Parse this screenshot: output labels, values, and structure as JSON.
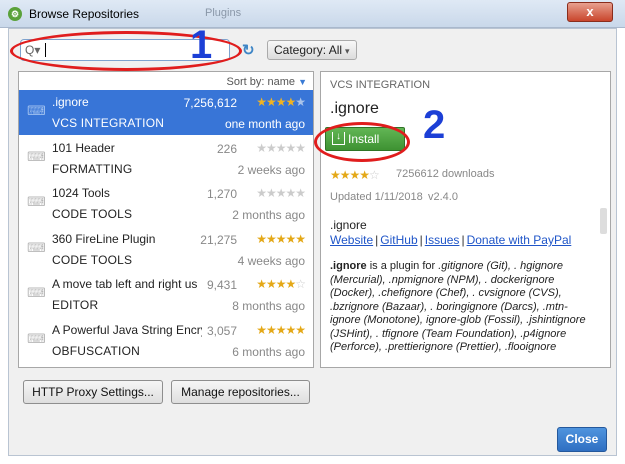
{
  "window": {
    "title": "Browse Repositories",
    "ghost_tab": "Plugins",
    "close_glyph": "x"
  },
  "search": {
    "value": "",
    "placeholder": "",
    "search_icon_glyph": "Q▾",
    "refresh_icon_glyph": "↻"
  },
  "category": {
    "label": "Category: All",
    "chevron": "▾"
  },
  "list": {
    "sort_label": "Sort by: name",
    "sort_arrow": "▼",
    "plugins": [
      {
        "name": ".ignore",
        "category": "VCS INTEGRATION",
        "downloads": "7,256,612",
        "rating_stars": 4.5,
        "stars_filled": "★★★★",
        "stars_empty": "★",
        "updated": "one month ago",
        "selected": true
      },
      {
        "name": "101 Header",
        "category": "FORMATTING",
        "downloads": "226",
        "rating_stars": 0,
        "stars_filled": "",
        "stars_empty": "★★★★★",
        "updated": "2 weeks ago",
        "selected": false
      },
      {
        "name": "1024 Tools",
        "category": "CODE TOOLS",
        "downloads": "1,270",
        "rating_stars": 0,
        "stars_filled": "",
        "stars_empty": "★★★★★",
        "updated": "2 months ago",
        "selected": false
      },
      {
        "name": "360 FireLine Plugin",
        "category": "CODE TOOLS",
        "downloads": "21,275",
        "rating_stars": 5,
        "stars_filled": "★★★★★",
        "stars_empty": "",
        "updated": "4 weeks ago",
        "selected": false
      },
      {
        "name": "A move tab left and right us",
        "category": "EDITOR",
        "downloads": "9,431",
        "rating_stars": 4,
        "stars_filled": "★★★★",
        "stars_empty": "☆",
        "updated": "8 months ago",
        "selected": false
      },
      {
        "name": "A Powerful Java String Encry",
        "category": "OBFUSCATION",
        "downloads": "3,057",
        "rating_stars": 5,
        "stars_filled": "★★★★★",
        "stars_empty": "",
        "updated": "6 months ago",
        "selected": false
      }
    ]
  },
  "detail": {
    "category": "VCS INTEGRATION",
    "name": ".ignore",
    "install_label": "Install",
    "install_glyph": "↓",
    "stars_filled": "★★★★",
    "stars_empty": "☆",
    "downloads": "7256612 downloads",
    "updated": "Updated 1/11/2018",
    "version": "v2.4.0",
    "plugin_label": ".ignore",
    "links": [
      "Website",
      "GitHub",
      "Issues",
      "Donate with PayPal"
    ],
    "link_sep": "|",
    "desc_bold": ".ignore",
    "desc_rest_1": " is a plugin for ",
    "desc_italic": ".gitignore (Git), . hgignore (Mercurial), .npmignore (NPM), . dockerignore (Docker), .chefignore (Chef), . cvsignore (CVS), .bzrignore (Bazaar), . boringignore (Darcs), .mtn-ignore (Monotone), ignore-glob (Fossil), .jshintignore (JSHint), . tfignore (Team Foundation), .p4ignore (Perforce), .prettierignore (Prettier), .flooignore"
  },
  "footer": {
    "proxy_label": "HTTP Proxy Settings...",
    "manage_label": "Manage repositories...",
    "close_label": "Close"
  },
  "annotations": {
    "marker_1": "1",
    "marker_2": "2",
    "ring_color": "#e01d1d",
    "number_color": "#1c3fd6"
  },
  "colors": {
    "selection": "#3875d7",
    "install_green": "#4fa443",
    "star_gold": "#e4a817",
    "link_blue": "#1f55c8"
  }
}
